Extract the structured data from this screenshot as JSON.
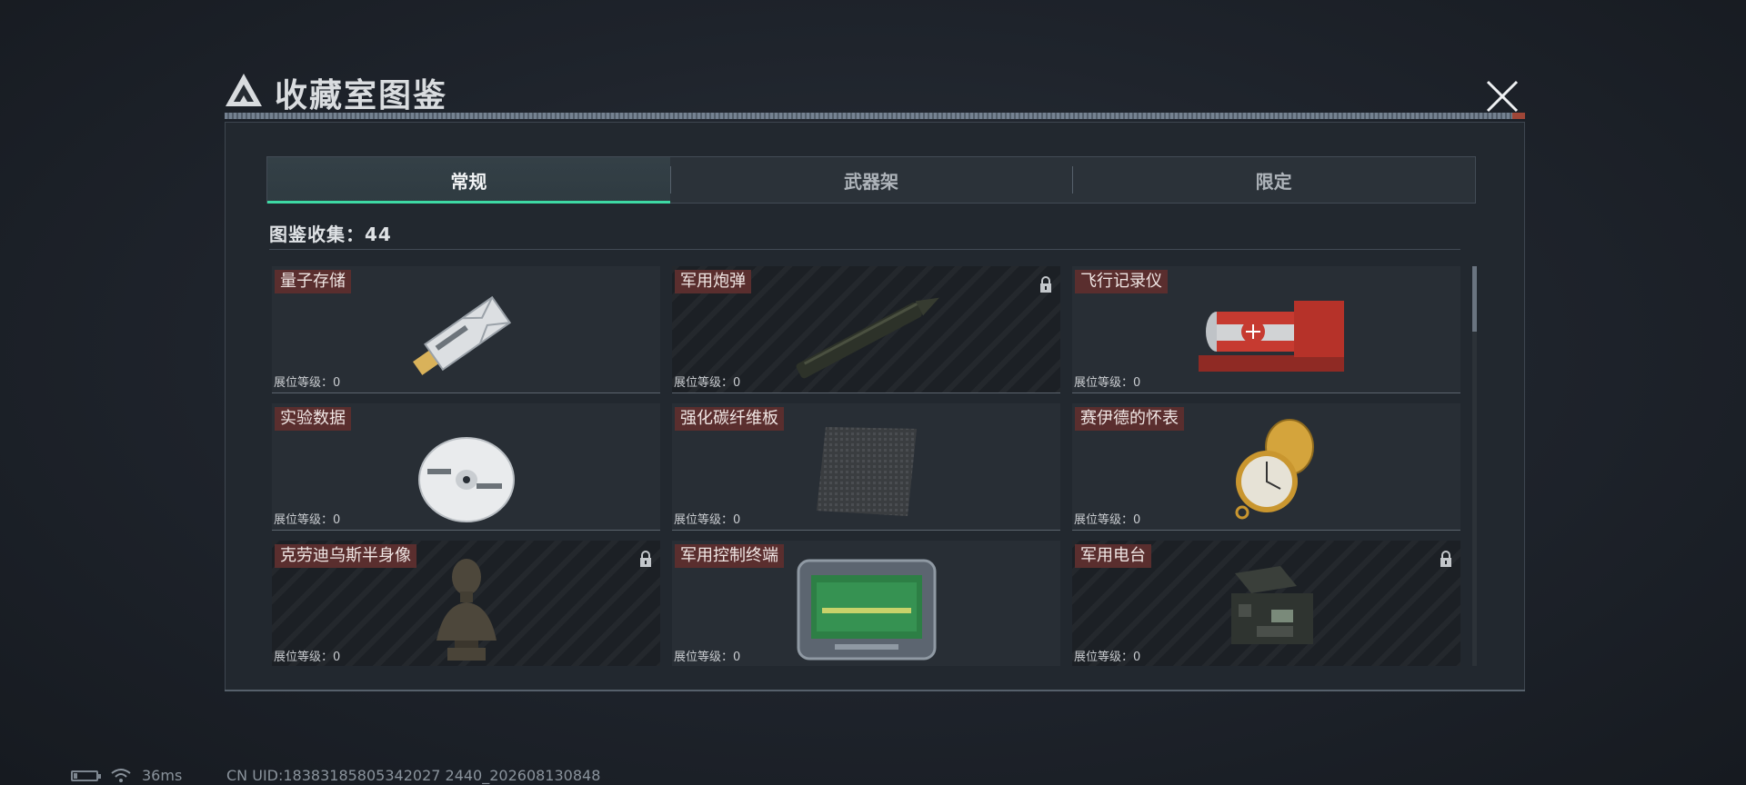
{
  "dialog": {
    "title": "收藏室图鉴"
  },
  "tabs": [
    {
      "label": "常规",
      "active": true
    },
    {
      "label": "武器架",
      "active": false
    },
    {
      "label": "限定",
      "active": false
    }
  ],
  "collection": {
    "label": "图鉴收集：44"
  },
  "items": [
    {
      "name": "量子存储",
      "level": "展位等级：0",
      "locked": false,
      "icon": "usb-drive-icon"
    },
    {
      "name": "军用炮弹",
      "level": "展位等级：0",
      "locked": true,
      "icon": "artillery-shell-icon"
    },
    {
      "name": "飞行记录仪",
      "level": "展位等级：0",
      "locked": false,
      "icon": "flight-recorder-icon"
    },
    {
      "name": "实验数据",
      "level": "展位等级：0",
      "locked": false,
      "icon": "data-disc-icon"
    },
    {
      "name": "强化碳纤维板",
      "level": "展位等级：0",
      "locked": false,
      "icon": "carbon-fiber-plate-icon"
    },
    {
      "name": "赛伊德的怀表",
      "level": "展位等级：0",
      "locked": false,
      "icon": "pocket-watch-icon"
    },
    {
      "name": "克劳迪乌斯半身像",
      "level": "展位等级：0",
      "locked": true,
      "icon": "bust-statue-icon"
    },
    {
      "name": "军用控制终端",
      "level": "展位等级：0",
      "locked": false,
      "icon": "control-terminal-icon"
    },
    {
      "name": "军用电台",
      "level": "展位等级：0",
      "locked": true,
      "icon": "military-radio-icon"
    }
  ],
  "status": {
    "ping": "36ms",
    "battery_level": 0.15,
    "uid": "CN UID:18383185805342027 2440_202608130848"
  },
  "colors": {
    "accent": "#3ed9a4",
    "name_tag": "#5a2e2e",
    "close_cap": "#c0503b"
  }
}
